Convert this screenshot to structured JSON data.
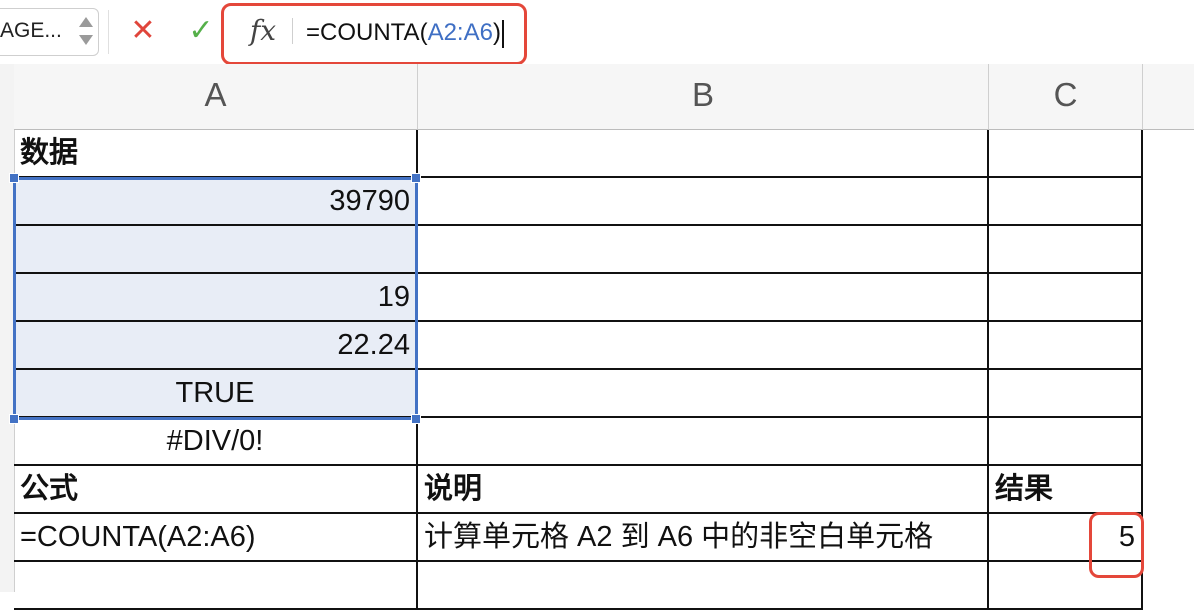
{
  "formula_bar": {
    "name_box": "AGE...",
    "cancel_glyph": "✕",
    "confirm_glyph": "✓",
    "fx_label": "fx",
    "formula_prefix": "=COUNTA(",
    "formula_ref": "A2:A6",
    "formula_suffix": ")"
  },
  "columns": [
    "A",
    "B",
    "C"
  ],
  "rows": [
    {
      "a": "数据",
      "b": "",
      "c": ""
    },
    {
      "a": "39790",
      "b": "",
      "c": ""
    },
    {
      "a": "",
      "b": "",
      "c": ""
    },
    {
      "a": "19",
      "b": "",
      "c": ""
    },
    {
      "a": "22.24",
      "b": "",
      "c": ""
    },
    {
      "a": "TRUE",
      "b": "",
      "c": ""
    },
    {
      "a": "#DIV/0!",
      "b": "",
      "c": ""
    },
    {
      "a": "公式",
      "b": "说明",
      "c": "结果"
    },
    {
      "a": "=COUNTA(A2:A6)",
      "b": "计算单元格 A2 到 A6 中的非空白单元格",
      "c": "5"
    },
    {
      "a": "",
      "b": "",
      "c": ""
    }
  ],
  "colors": {
    "selection_border": "#4372c4",
    "selection_fill": "#e8edf6",
    "highlight_red": "#e4473a",
    "cancel_red": "#e0453b",
    "confirm_green": "#55b04a",
    "reference_blue": "#3f6fc4"
  }
}
